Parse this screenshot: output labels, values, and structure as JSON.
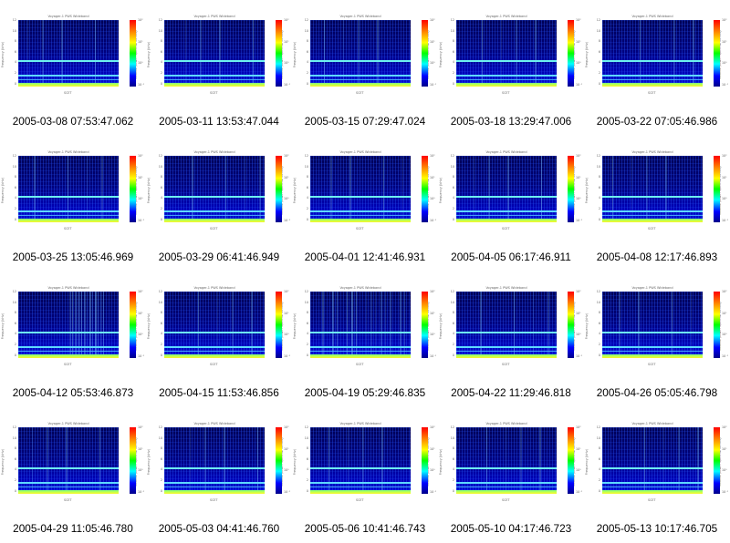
{
  "chart_data": {
    "type": "heatmap",
    "layout": "4 rows x 5 columns of small spectrogram panels",
    "panel_plot_title": "Voyager-1 PWS Wideband",
    "panel_ylabel": "Frequency (kHz)",
    "panel_colorbar_label": "relative power spectral density",
    "y_tick_labels": [
      "12",
      "10",
      "8",
      "6",
      "4",
      "2",
      "0"
    ],
    "colorbar_tick_labels": [
      "10²",
      "10¹",
      "10⁰",
      "10⁻¹"
    ],
    "x_axis_labels": "SCET",
    "colorscale": [
      "#ff0000",
      "#ff8800",
      "#ffff00",
      "#00ff00",
      "#00ffff",
      "#0000ff",
      "#00008b"
    ],
    "panels": [
      {
        "caption": "2005-03-08 07:53:47.062"
      },
      {
        "caption": "2005-03-11 13:53:47.044"
      },
      {
        "caption": "2005-03-15 07:29:47.024"
      },
      {
        "caption": "2005-03-18 13:29:47.006"
      },
      {
        "caption": "2005-03-22 07:05:46.986"
      },
      {
        "caption": "2005-03-25 13:05:46.969"
      },
      {
        "caption": "2005-03-29 06:41:46.949"
      },
      {
        "caption": "2005-04-01 12:41:46.931"
      },
      {
        "caption": "2005-04-05 06:17:46.911"
      },
      {
        "caption": "2005-04-08 12:17:46.893"
      },
      {
        "caption": "2005-04-12 05:53:46.873"
      },
      {
        "caption": "2005-04-15 11:53:46.856"
      },
      {
        "caption": "2005-04-19 05:29:46.835"
      },
      {
        "caption": "2005-04-22 11:29:46.818"
      },
      {
        "caption": "2005-04-26 05:05:46.798"
      },
      {
        "caption": "2005-04-29 11:05:46.780"
      },
      {
        "caption": "2005-05-03 04:41:46.760"
      },
      {
        "caption": "2005-05-06 10:41:46.743"
      },
      {
        "caption": "2005-05-10 04:17:46.723"
      },
      {
        "caption": "2005-05-13 10:17:46.705"
      }
    ]
  }
}
